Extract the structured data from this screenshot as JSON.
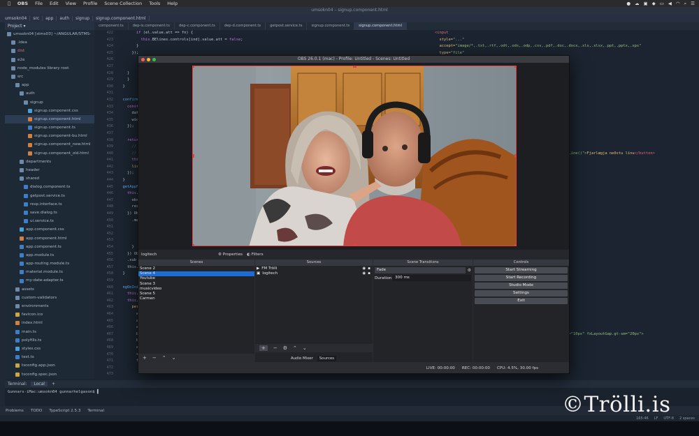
{
  "menubar": {
    "apple": "",
    "items": [
      "OBS",
      "File",
      "Edit",
      "View",
      "Profile",
      "Scene Collection",
      "Tools",
      "Help"
    ]
  },
  "ide": {
    "window_title": "umsokn04 – signup.component.html",
    "nav": [
      "umsokn04",
      "src",
      "app",
      "auth",
      "signup",
      "signup.component.html"
    ],
    "project_label": "Project",
    "tabs": [
      "component.ts",
      "dep-is.component.ts",
      "dep-c.component.ts",
      "dep-d.component.ts",
      "getpost.service.ts",
      "signup.component.ts",
      "signup.component.html"
    ],
    "tree": [
      {
        "label": "umsokn04 [stms03] ~/ANGULAR/STMS-",
        "type": "fold",
        "indent": 0
      },
      {
        "label": ".idea",
        "type": "fold",
        "indent": 1
      },
      {
        "label": "dist",
        "type": "fold",
        "indent": 1,
        "red": true
      },
      {
        "label": "e2e",
        "type": "fold",
        "indent": 1
      },
      {
        "label": "node_modules library root",
        "type": "fold",
        "indent": 1
      },
      {
        "label": "src",
        "type": "fold",
        "indent": 1
      },
      {
        "label": "app",
        "type": "fold",
        "indent": 2
      },
      {
        "label": "auth",
        "type": "fold",
        "indent": 3
      },
      {
        "label": "signup",
        "type": "fold",
        "indent": 4
      },
      {
        "label": "signup.component.css",
        "type": "css",
        "indent": 5
      },
      {
        "label": "signup.component.html",
        "type": "html",
        "indent": 5
      },
      {
        "label": "signup.component.ts",
        "type": "ts",
        "indent": 5
      },
      {
        "label": "signup.component-bu.html",
        "type": "html",
        "indent": 5
      },
      {
        "label": "signup.component_new.html",
        "type": "html",
        "indent": 5
      },
      {
        "label": "signup.component_old.html",
        "type": "html",
        "indent": 5
      },
      {
        "label": "departments",
        "type": "fold",
        "indent": 3
      },
      {
        "label": "header",
        "type": "fold",
        "indent": 3
      },
      {
        "label": "shared",
        "type": "fold",
        "indent": 3
      },
      {
        "label": "dialog.component.ts",
        "type": "ts",
        "indent": 4
      },
      {
        "label": "getpost.service.ts",
        "type": "ts",
        "indent": 4
      },
      {
        "label": "resp.interface.ts",
        "type": "ts",
        "indent": 4
      },
      {
        "label": "save.dialog.ts",
        "type": "ts",
        "indent": 4
      },
      {
        "label": "ui.service.ts",
        "type": "ts",
        "indent": 4
      },
      {
        "label": "app.component.css",
        "type": "css",
        "indent": 3
      },
      {
        "label": "app.component.html",
        "type": "html",
        "indent": 3
      },
      {
        "label": "app.component.ts",
        "type": "ts",
        "indent": 3
      },
      {
        "label": "app.module.ts",
        "type": "ts",
        "indent": 3
      },
      {
        "label": "app-routing.module.ts",
        "type": "ts",
        "indent": 3
      },
      {
        "label": "material.module.ts",
        "type": "ts",
        "indent": 3
      },
      {
        "label": "my-date-adapter.ts",
        "type": "ts",
        "indent": 3
      },
      {
        "label": "assets",
        "type": "fold",
        "indent": 2
      },
      {
        "label": "custom-validators",
        "type": "fold",
        "indent": 2
      },
      {
        "label": "environments",
        "type": "fold",
        "indent": 2
      },
      {
        "label": "favicon.ico",
        "type": "json",
        "indent": 2
      },
      {
        "label": "index.html",
        "type": "html",
        "indent": 2
      },
      {
        "label": "main.ts",
        "type": "ts",
        "indent": 2
      },
      {
        "label": "polyfills.ts",
        "type": "ts",
        "indent": 2
      },
      {
        "label": "styles.css",
        "type": "css",
        "indent": 2
      },
      {
        "label": "test.ts",
        "type": "ts",
        "indent": 2
      },
      {
        "label": "tsconfig.app.json",
        "type": "json",
        "indent": 2
      },
      {
        "label": "tsconfig.spec.json",
        "type": "json",
        "indent": 2
      },
      {
        "label": "typings.d.ts",
        "type": "ts",
        "indent": 2
      }
    ],
    "terminal": {
      "tab_label": "Terminal:",
      "local": "Local",
      "prompt": "Gunnars-iMac:umsokn04 gunnarhelgason$"
    },
    "tool_tabs": [
      "Problems",
      "TODO",
      "TypeScript 2.5.3",
      "Terminal"
    ],
    "status": [
      "165:46",
      "LF",
      "UTF-8",
      "2 spaces"
    ]
  },
  "obs": {
    "title": "OBS 26.0.1 (mac) - Profile: Untitled - Scenes: Untitled",
    "source_name": "logitech",
    "properties_label": "Properties",
    "filters_label": "Filters",
    "scenes_header": "Scenes",
    "scenes": [
      "Scene 2",
      "Scene 4",
      "Youtube",
      "Scene 3",
      "musicvideo",
      "Scene 5",
      "Carmen"
    ],
    "selected_scene": "Scene 4",
    "sources_header": "Sources",
    "sources": [
      {
        "name": "FM Trölli",
        "icon": "play-icon"
      },
      {
        "name": "logitech",
        "icon": "camera-icon"
      }
    ],
    "transitions_header": "Scene Transitions",
    "transition": "Fade",
    "duration_label": "Duration",
    "duration_value": "300 ms",
    "controls_header": "Controls",
    "controls": [
      "Start Streaming",
      "Start Recording",
      "Studio Mode",
      "Settings",
      "Exit"
    ],
    "bottom_tabs": [
      "Audio Mixer",
      "Sources"
    ],
    "status": {
      "live": "LIVE: 00:00:00",
      "rec": "REC: 00:00:00",
      "cpu": "CPU: 4.5%, 30.00 fps"
    }
  },
  "watermark": "©Trölli.is",
  "colors": {
    "selection": "#1e6bd6",
    "red_outline": "#e04040"
  }
}
